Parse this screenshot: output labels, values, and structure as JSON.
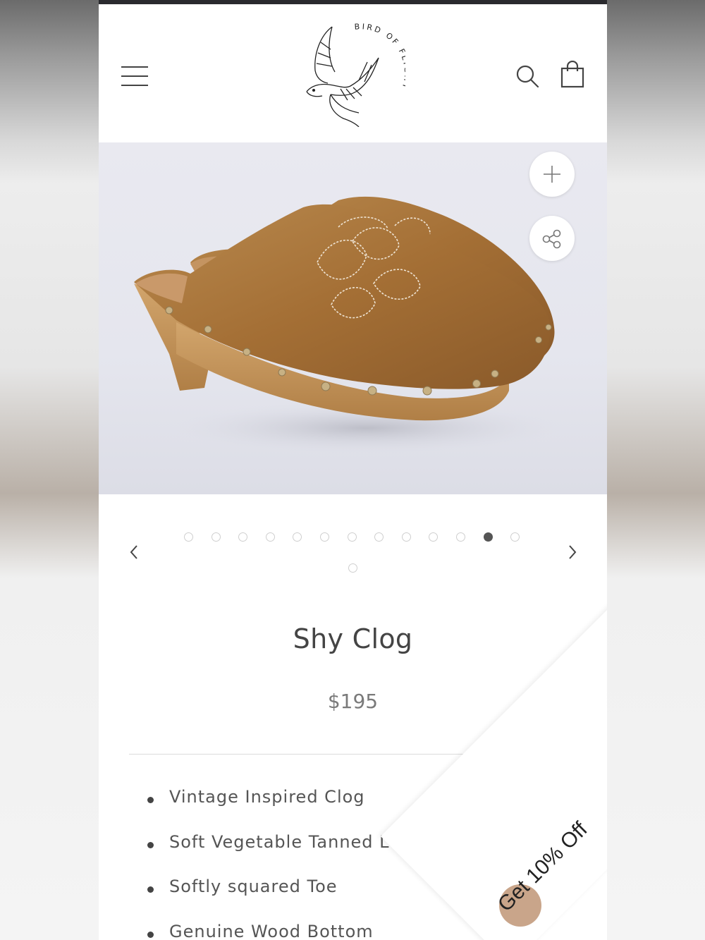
{
  "brand": {
    "logo_text": "BIRD OF FLIGHT"
  },
  "header": {
    "menu_icon": "hamburger-menu-icon",
    "search_icon": "search-icon",
    "cart_icon": "shopping-bag-icon"
  },
  "gallery": {
    "zoom_icon": "plus-icon",
    "share_icon": "share-icon",
    "slide_count": 14,
    "active_slide": 12
  },
  "product": {
    "title": "Shy Clog",
    "price": "$195",
    "features": [
      "Vintage Inspired Clog",
      "Soft Vegetable Tanned Leather Upper",
      "Softly squared Toe",
      "Genuine Wood Bottom"
    ]
  },
  "promo": {
    "label": "Get 10% Off"
  },
  "colors": {
    "accent_dark": "#555555",
    "text": "#444444",
    "suede": "#a9773f"
  }
}
